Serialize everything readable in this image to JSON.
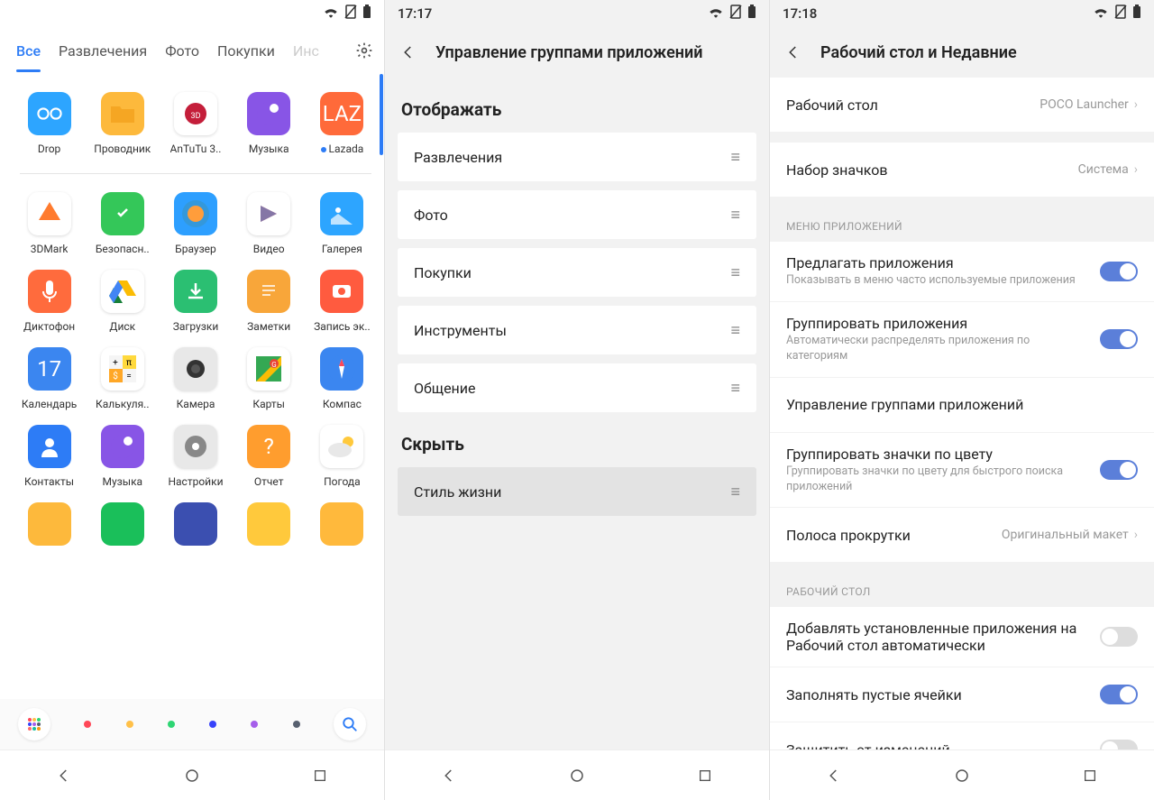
{
  "panel1": {
    "tabs": [
      "Все",
      "Развлечения",
      "Фото",
      "Покупки",
      "Инс"
    ],
    "active_tab": 0,
    "apps_row1": [
      {
        "label": "Drop",
        "bg": "#2da5ff",
        "dot": false
      },
      {
        "label": "Проводник",
        "bg": "#fdb93c",
        "dot": false
      },
      {
        "label": "AnTuTu 3..",
        "bg": "#ffffff",
        "dot": false
      },
      {
        "label": "Музыка",
        "bg": "#8855e6",
        "dot": false
      },
      {
        "label": "Lazada",
        "bg": "#ff6a3a",
        "dot": true
      }
    ],
    "apps_rest": [
      {
        "label": "3DMark",
        "bg": "#ffffff"
      },
      {
        "label": "Безопасн..",
        "bg": "#34c759"
      },
      {
        "label": "Браузер",
        "bg": "#2d9fff"
      },
      {
        "label": "Видео",
        "bg": "#ffffff"
      },
      {
        "label": "Галерея",
        "bg": "#2da5ff"
      },
      {
        "label": "Диктофон",
        "bg": "#ff6b3d"
      },
      {
        "label": "Диск",
        "bg": "#ffffff"
      },
      {
        "label": "Загрузки",
        "bg": "#2bbf72"
      },
      {
        "label": "Заметки",
        "bg": "#f8a63a"
      },
      {
        "label": "Запись эк..",
        "bg": "#ff5b3f"
      },
      {
        "label": "Календарь",
        "bg": "#3b86f0"
      },
      {
        "label": "Калькуля..",
        "bg": "#ffffff"
      },
      {
        "label": "Камера",
        "bg": "#e8e8e8"
      },
      {
        "label": "Карты",
        "bg": "#ffffff"
      },
      {
        "label": "Компас",
        "bg": "#3b86f0"
      },
      {
        "label": "Контакты",
        "bg": "#2d7cf6"
      },
      {
        "label": "Музыка",
        "bg": "#8855e6"
      },
      {
        "label": "Настройки",
        "bg": "#e8e8e8"
      },
      {
        "label": "Отчет",
        "bg": "#ff9d2e"
      },
      {
        "label": "Погода",
        "bg": "#ffffff"
      }
    ],
    "apps_partial": [
      {
        "bg": "#fdb93c"
      },
      {
        "bg": "#1abf5a"
      },
      {
        "bg": "#3b4fb0"
      },
      {
        "bg": "#ffc93c"
      },
      {
        "bg": "#ffb93c"
      }
    ],
    "color_dots": [
      "#ff4757",
      "#ffc048",
      "#2ed573",
      "#3742fa",
      "#a55eea",
      "#57606f"
    ]
  },
  "panel2": {
    "time": "17:17",
    "header": "Управление группами приложений",
    "show_heading": "Отображать",
    "show_items": [
      "Развлечения",
      "Фото",
      "Покупки",
      "Инструменты",
      "Общение"
    ],
    "hide_heading": "Скрыть",
    "hide_items": [
      "Стиль жизни"
    ]
  },
  "panel3": {
    "time": "17:18",
    "header": "Рабочий стол и Недавние",
    "row_launcher_title": "Рабочий стол",
    "row_launcher_value": "POCO Launcher",
    "row_iconpack_title": "Набор значков",
    "row_iconpack_value": "Система",
    "section_menu": "МЕНЮ ПРИЛОЖЕНИЙ",
    "row_suggest_title": "Предлагать приложения",
    "row_suggest_sub": "Показывать в меню часто используемые приложения",
    "row_group_title": "Группировать приложения",
    "row_group_sub": "Автоматически распределять приложения по категориям",
    "row_manage_title": "Управление группами приложений",
    "row_color_title": "Группировать значки по цвету",
    "row_color_sub": "Группировать значки по цвету для быстрого поиска приложений",
    "row_scroll_title": "Полоса прокрутки",
    "row_scroll_value": "Оригинальный макет",
    "section_desk": "РАБОЧИЙ СТОЛ",
    "row_autoadd_title": "Добавлять установленные приложения на Рабочий стол автоматически",
    "row_fill_title": "Заполнять пустые ячейки",
    "row_protect_title": "Защитить от изменений"
  }
}
